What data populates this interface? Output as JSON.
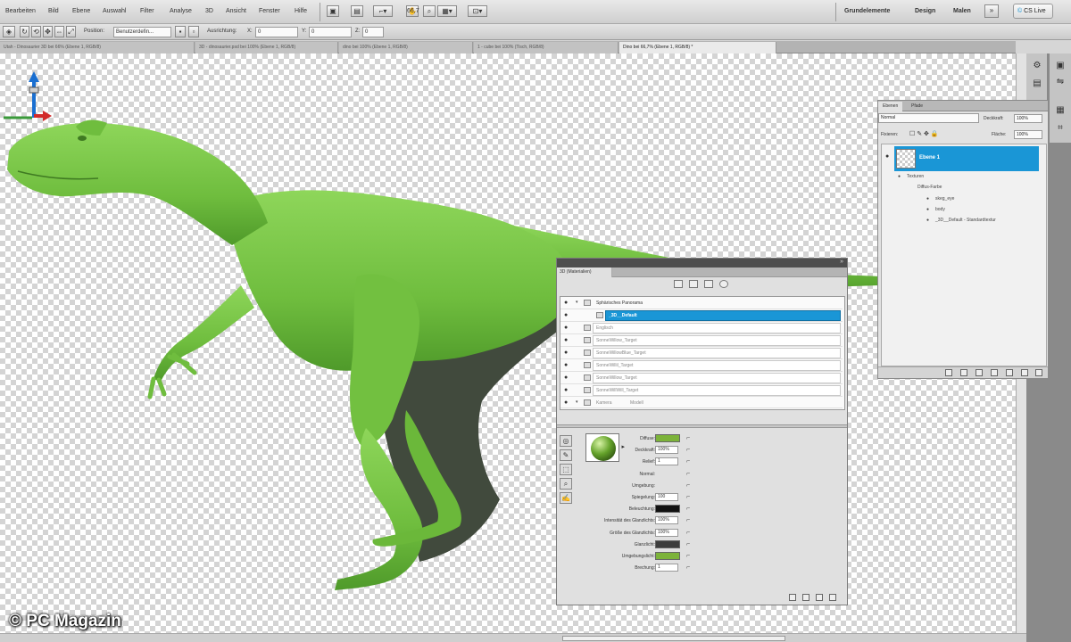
{
  "menu": {
    "items": [
      "Bearbeiten",
      "Bild",
      "Ebene",
      "Auswahl",
      "Filter",
      "Analyse",
      "3D",
      "Ansicht",
      "Fenster",
      "Hilfe"
    ],
    "zoom": "66,7",
    "workspaces": [
      "Grundelemente",
      "Design",
      "Malen"
    ],
    "cslive": "CS Live"
  },
  "options": {
    "position_label": "Position:",
    "position_value": "Benutzerdefin...",
    "ausrichtung_label": "Ausrichtung:",
    "x_label": "X:",
    "x_value": "0",
    "y_label": "Y:",
    "y_value": "0",
    "z_label": "Z:",
    "z_value": "0"
  },
  "doc_tabs": [
    "Utah - Dinosaurier 3D bei 66% (Ebene 1, RGB/8)",
    "3D - dinosaurier.psd bei 100% (Ebene 1, RGB/8)",
    "dino bei 100% (Ebene 1, RGB/8)",
    "1 - cube bei 100% (Tisch, RGB/8)",
    "Dino bei 66,7% (Ebene 1, RGB/8) *"
  ],
  "layers_panel": {
    "tabs": [
      "Ebenen",
      "Pfade"
    ],
    "blend_mode": "Normal",
    "opacity_label": "Deckkraft:",
    "opacity_value": "100%",
    "lock_label": "Fixieren:",
    "fill_label": "Fläche:",
    "fill_value": "100%",
    "layer_name": "Ebene 1",
    "sub_items": [
      "Texturen",
      "Diffus-Farbe",
      "skeg_eye",
      "body",
      "_3D__Default - Standardtextur"
    ]
  },
  "panel_3d": {
    "title": "3D (Materialien)",
    "scene_items": [
      {
        "name": "Sphärisches Panorama",
        "selected": false
      },
      {
        "name": "_3D__Default",
        "selected": true
      },
      {
        "name": "Englisch",
        "selected": false
      },
      {
        "name": "SonneWillow_Target",
        "selected": false
      },
      {
        "name": "SonneWillowBlue_Target",
        "selected": false
      },
      {
        "name": "SonneWillil_Target",
        "selected": false
      },
      {
        "name": "SonneWillow_Target",
        "selected": false
      },
      {
        "name": "SonneWillWill_Target",
        "selected": false
      },
      {
        "name": "Kamera",
        "selected": false
      },
      {
        "name": "Modell",
        "selected": false
      }
    ],
    "properties": [
      {
        "label": "Diffuse:",
        "kind": "swatch",
        "color": "#7cb33a"
      },
      {
        "label": "Deckkraft:",
        "kind": "field",
        "value": "100%"
      },
      {
        "label": "Relief:",
        "kind": "field",
        "value": "1"
      },
      {
        "label": "Normal:",
        "kind": "none"
      },
      {
        "label": "Umgebung:",
        "kind": "none"
      },
      {
        "label": "Spiegelung:",
        "kind": "field",
        "value": "100"
      },
      {
        "label": "Beleuchtung:",
        "kind": "swatch",
        "color": "#111111"
      },
      {
        "label": "Intensität des Glanzlichts:",
        "kind": "field",
        "value": "100%"
      },
      {
        "label": "Größe des Glanzlichts:",
        "kind": "field",
        "value": "100%"
      },
      {
        "label": "Glanzlicht:",
        "kind": "swatch",
        "color": "#3d3d3d"
      },
      {
        "label": "Umgebungslicht:",
        "kind": "swatch",
        "color": "#7cb33a"
      },
      {
        "label": "Brechung:",
        "kind": "field",
        "value": "1"
      }
    ]
  },
  "watermark": "© PC Magazin",
  "colors": {
    "accent": "#1a96d6",
    "dino": "#7cc443",
    "dino_shadow": "#3f4a3a",
    "canvas_check": "#d4d4d4"
  }
}
